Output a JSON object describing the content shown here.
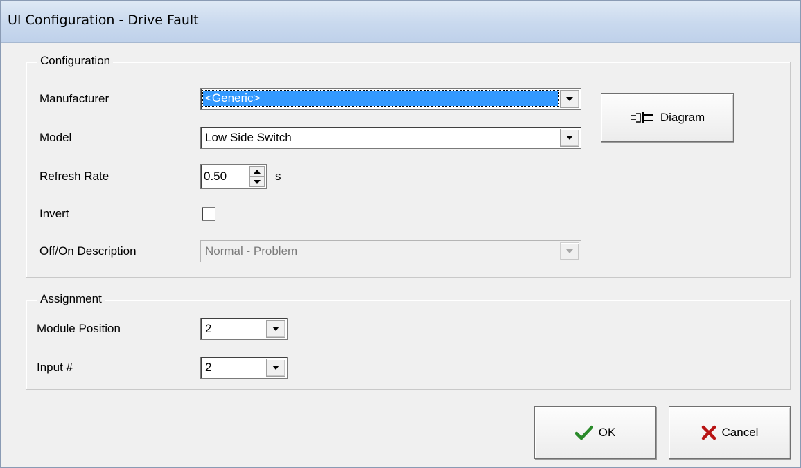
{
  "window": {
    "title": "UI Configuration - Drive Fault"
  },
  "configuration": {
    "legend": "Configuration",
    "manufacturer": {
      "label": "Manufacturer",
      "value": "<Generic>"
    },
    "model": {
      "label": "Model",
      "value": "Low Side Switch"
    },
    "refresh_rate": {
      "label": "Refresh Rate",
      "value": "0.50",
      "unit": "s"
    },
    "invert": {
      "label": "Invert",
      "checked": false
    },
    "off_on_description": {
      "label": "Off/On Description",
      "value": "Normal - Problem",
      "enabled": false
    },
    "diagram_button": {
      "label": "Diagram",
      "icon": "plug-icon"
    }
  },
  "assignment": {
    "legend": "Assignment",
    "module_position": {
      "label": "Module Position",
      "value": "2"
    },
    "input_number": {
      "label": "Input #",
      "value": "2"
    }
  },
  "buttons": {
    "ok": {
      "label": "OK",
      "icon": "checkmark-icon",
      "icon_color": "#2a8a2a"
    },
    "cancel": {
      "label": "Cancel",
      "icon": "x-icon",
      "icon_color": "#b81414"
    }
  },
  "colors": {
    "selection": "#3399ff",
    "titlebar": "#c9d9ee",
    "face": "#f0f0f0"
  }
}
